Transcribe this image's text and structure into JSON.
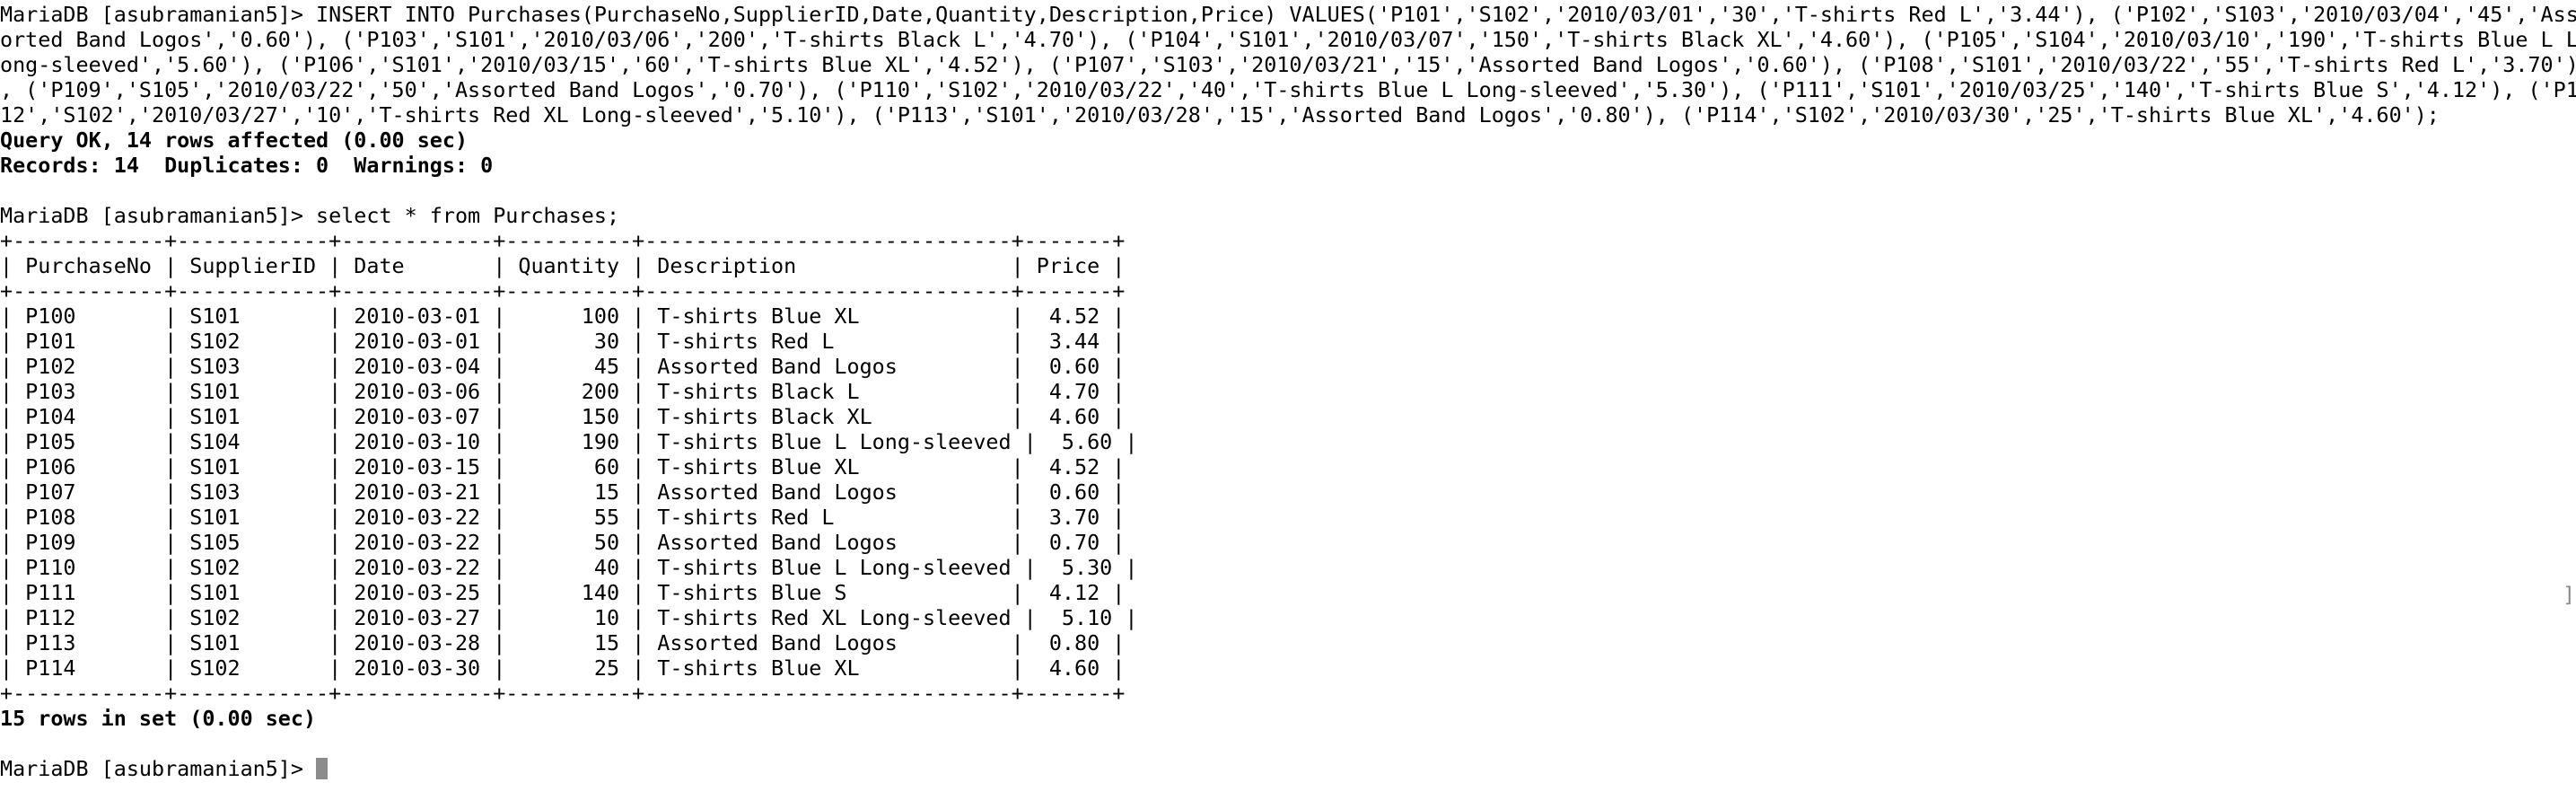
{
  "terminal": {
    "lines": [
      {
        "text": "MariaDB [asubramanian5]> INSERT INTO Purchases(PurchaseNo,SupplierID,Date,Quantity,Description,Price) VALUES('P101','S102','2010/03/01','30','T-shirts Red L','3.44'), ('P102','S103','2010/03/04','45','Ass",
        "bold": false
      },
      {
        "text": "orted Band Logos','0.60'), ('P103','S101','2010/03/06','200','T-shirts Black L','4.70'), ('P104','S101','2010/03/07','150','T-shirts Black XL','4.60'), ('P105','S104','2010/03/10','190','T-shirts Blue L L",
        "bold": false
      },
      {
        "text": "ong-sleeved','5.60'), ('P106','S101','2010/03/15','60','T-shirts Blue XL','4.52'), ('P107','S103','2010/03/21','15','Assorted Band Logos','0.60'), ('P108','S101','2010/03/22','55','T-shirts Red L','3.70')",
        "bold": false
      },
      {
        "text": ", ('P109','S105','2010/03/22','50','Assorted Band Logos','0.70'), ('P110','S102','2010/03/22','40','T-shirts Blue L Long-sleeved','5.30'), ('P111','S101','2010/03/25','140','T-shirts Blue S','4.12'), ('P1",
        "bold": false
      },
      {
        "text": "12','S102','2010/03/27','10','T-shirts Red XL Long-sleeved','5.10'), ('P113','S101','2010/03/28','15','Assorted Band Logos','0.80'), ('P114','S102','2010/03/30','25','T-shirts Blue XL','4.60');",
        "bold": false
      },
      {
        "text": "Query OK, 14 rows affected (0.00 sec)",
        "bold": true
      },
      {
        "text": "Records: 14  Duplicates: 0  Warnings: 0",
        "bold": true
      },
      {
        "text": "",
        "bold": false
      },
      {
        "text": "MariaDB [asubramanian5]> select * from Purchases;",
        "bold": false
      },
      {
        "text": "+------------+------------+------------+----------+-----------------------------+-------+",
        "bold": false
      },
      {
        "text": "| PurchaseNo | SupplierID | Date       | Quantity | Description                 | Price |",
        "bold": false
      },
      {
        "text": "+------------+------------+------------+----------+-----------------------------+-------+",
        "bold": false
      },
      {
        "text": "| P100       | S101       | 2010-03-01 |      100 | T-shirts Blue XL            |  4.52 |",
        "bold": false
      },
      {
        "text": "| P101       | S102       | 2010-03-01 |       30 | T-shirts Red L              |  3.44 |",
        "bold": false
      },
      {
        "text": "| P102       | S103       | 2010-03-04 |       45 | Assorted Band Logos         |  0.60 |",
        "bold": false
      },
      {
        "text": "| P103       | S101       | 2010-03-06 |      200 | T-shirts Black L            |  4.70 |",
        "bold": false
      },
      {
        "text": "| P104       | S101       | 2010-03-07 |      150 | T-shirts Black XL           |  4.60 |",
        "bold": false
      },
      {
        "text": "| P105       | S104       | 2010-03-10 |      190 | T-shirts Blue L Long-sleeved |  5.60 |",
        "bold": false
      },
      {
        "text": "| P106       | S101       | 2010-03-15 |       60 | T-shirts Blue XL            |  4.52 |",
        "bold": false
      },
      {
        "text": "| P107       | S103       | 2010-03-21 |       15 | Assorted Band Logos         |  0.60 |",
        "bold": false
      },
      {
        "text": "| P108       | S101       | 2010-03-22 |       55 | T-shirts Red L              |  3.70 |",
        "bold": false
      },
      {
        "text": "| P109       | S105       | 2010-03-22 |       50 | Assorted Band Logos         |  0.70 |",
        "bold": false
      },
      {
        "text": "| P110       | S102       | 2010-03-22 |       40 | T-shirts Blue L Long-sleeved |  5.30 |",
        "bold": false
      },
      {
        "text": "| P111       | S101       | 2010-03-25 |      140 | T-shirts Blue S             |  4.12 |",
        "bold": false
      },
      {
        "text": "| P112       | S102       | 2010-03-27 |       10 | T-shirts Red XL Long-sleeved |  5.10 |",
        "bold": false
      },
      {
        "text": "| P113       | S101       | 2010-03-28 |       15 | Assorted Band Logos         |  0.80 |",
        "bold": false
      },
      {
        "text": "| P114       | S102       | 2010-03-30 |       25 | T-shirts Blue XL            |  4.60 |",
        "bold": false
      },
      {
        "text": "+------------+------------+------------+----------+-----------------------------+-------+",
        "bold": false
      },
      {
        "text": "15 rows in set (0.00 sec)",
        "bold": true
      },
      {
        "text": "",
        "bold": false
      }
    ],
    "prompt": "MariaDB [asubramanian5]> ",
    "right_marker": "]",
    "colors": {
      "background": "#ffffff",
      "text": "#000000",
      "cursor": "#8c8c8c"
    }
  }
}
